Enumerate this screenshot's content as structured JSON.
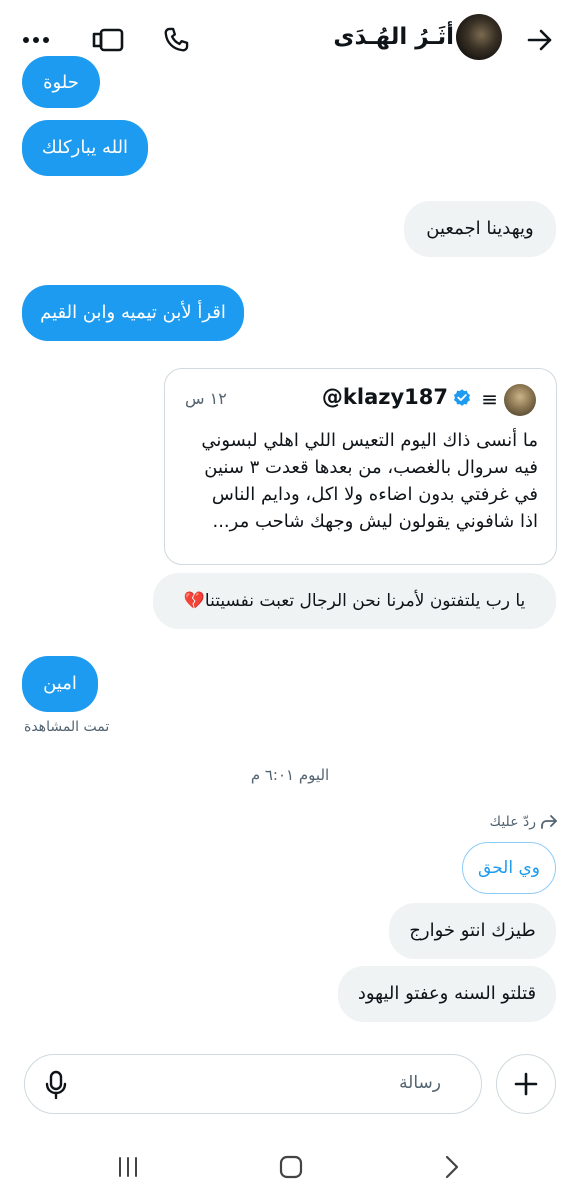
{
  "header": {
    "contact_name": "أثَـرُ الهُـدَى",
    "more_icon": "more-icon",
    "video_icon": "video-call-icon",
    "phone_icon": "phone-icon",
    "back_icon": "arrow-right-icon"
  },
  "messages": [
    {
      "id": "m0",
      "side": "me",
      "text": "حلوة"
    },
    {
      "id": "m1",
      "side": "me",
      "text": "الله يباركلك"
    },
    {
      "id": "m2",
      "side": "them",
      "text": "ويهدينا اجمعين"
    },
    {
      "id": "m3",
      "side": "me",
      "text": "اقرأ لأبن تيميه وابن القيم"
    },
    {
      "id": "m4",
      "side": "them",
      "text": "يا رب يلتفتون لأمرنا نحن الرجال تعبت نفسيتنا💔"
    },
    {
      "id": "m5",
      "side": "me",
      "text": "امين"
    },
    {
      "id": "m6",
      "side": "them",
      "text": "طيزك انتو خوارج"
    },
    {
      "id": "m7",
      "side": "them",
      "text": "قتلتو السنه وعفتو اليهود"
    }
  ],
  "quoted_tweet": {
    "handle": "@klazy187",
    "time": "١٢ س",
    "lines": [
      "ما أنسى ذاك اليوم التعيس اللي اهلي لبسوني",
      "فيه سروال بالغصب، من بعدها قعدت ٣ سنين",
      "في غرفتي بدون اضاءه ولا اكل، ودايم الناس",
      "اذا شافوني يقولون ليش وجهك شاحب مر..."
    ]
  },
  "seen_label": "تمت المشاهدة",
  "timestamp": "اليوم ٦:٠١ م",
  "reply": {
    "label": "ردّ عليك",
    "quoted_text": "وي الحق"
  },
  "composer": {
    "placeholder": "رسالة"
  },
  "colors": {
    "accent": "#1d9bf0",
    "bubble_received": "#eff3f4",
    "muted_text": "#536471"
  }
}
